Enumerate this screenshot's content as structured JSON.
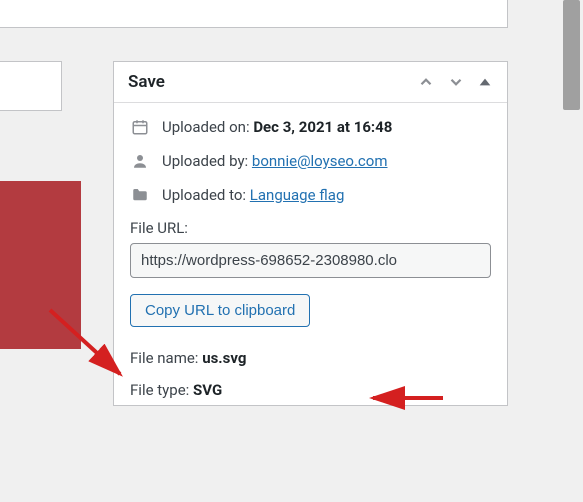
{
  "panel": {
    "title": "Save"
  },
  "meta": {
    "uploaded_on_label": "Uploaded on:",
    "uploaded_on_value": "Dec 3, 2021 at 16:48",
    "uploaded_by_label": "Uploaded by:",
    "uploaded_by_link": "bonnie@loyseo.com",
    "uploaded_to_label": "Uploaded to:",
    "uploaded_to_link": "Language flag"
  },
  "file_url": {
    "label": "File URL:",
    "value": "https://wordpress-698652-2308980.clo"
  },
  "copy_button_label": "Copy URL to clipboard",
  "file_name": {
    "label": "File name:",
    "value": "us.svg"
  },
  "file_type": {
    "label": "File type:",
    "value": "SVG"
  }
}
